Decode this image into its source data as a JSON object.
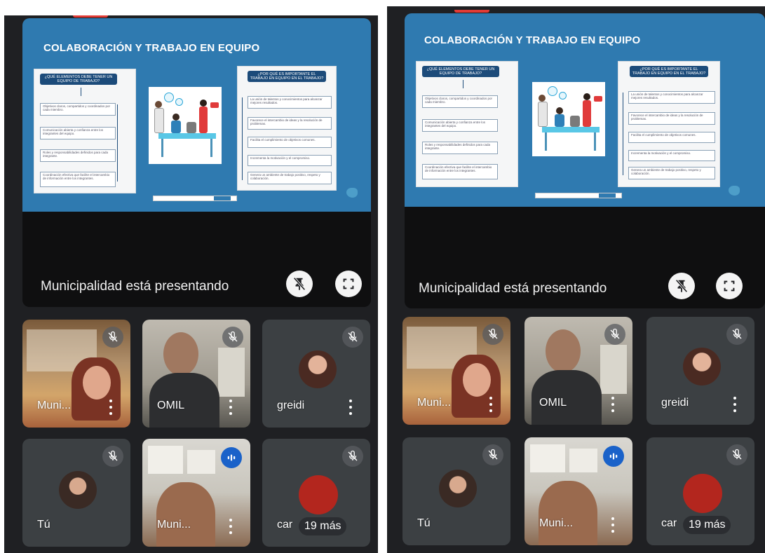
{
  "slide": {
    "title": "COLABORACIÓN Y TRABAJO EN EQUIPO",
    "left_heading": "¿QUÉ ELEMENTOS DEBE TENER UN EQUIPO DE TRABAJO?",
    "right_heading": "¿POR QUÉ ES IMPORTANTE EL TRABAJO EN EQUIPO EN EL TRABAJO?"
  },
  "presentation": {
    "presenting_text": "Municipalidad está presentando"
  },
  "participants": [
    {
      "name": "Muni...",
      "muted": true
    },
    {
      "name": "OMIL",
      "muted": true
    },
    {
      "name": "greidi",
      "muted": true
    },
    {
      "name": "Tú",
      "muted": true
    },
    {
      "name": "Muni...",
      "muted": false,
      "speaking": true
    },
    {
      "name": "car",
      "muted": true
    }
  ],
  "more_participants": "19 más",
  "colors": {
    "background": "#1f2023",
    "slide_blue": "#2f7ab0",
    "speaking_blue": "#1a62c9",
    "accent_red": "#e23b36"
  },
  "icons": [
    "mic-off-icon",
    "pin-off-icon",
    "fullscreen-icon",
    "more-vert-icon",
    "audio-level-icon"
  ]
}
